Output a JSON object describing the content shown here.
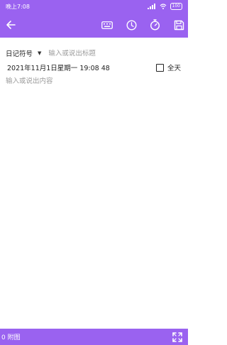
{
  "statusbar": {
    "time": "晚上7:08",
    "battery": "100"
  },
  "toolbar": {
    "back_icon": "arrow-left-icon",
    "keyboard_icon": "keyboard-icon",
    "clock_icon": "clock-icon",
    "timer_icon": "stopwatch-icon",
    "save_icon": "save-icon"
  },
  "editor": {
    "symbol_label": "日记符号",
    "dropdown_glyph": "▼",
    "title_placeholder": "输入或说出标题",
    "datetime": "2021年11月1日星期一 19:08 48",
    "all_day_label": "全天",
    "all_day_checked": false,
    "content_placeholder": "输入或说出内容"
  },
  "footer": {
    "attachments_label": "0 附图"
  },
  "colors": {
    "primary": "#9a62f0",
    "placeholder": "#9a9a9a"
  }
}
